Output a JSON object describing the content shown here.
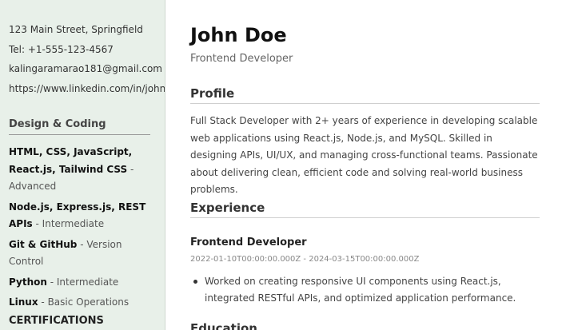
{
  "contact": {
    "address": "123 Main Street, Springfield",
    "phone": "Tel: +1-555-123-4567",
    "email": "kalingaramarao181@gmail.com",
    "linkedin": "https://www.linkedin.com/in/johndoe"
  },
  "skills": {
    "title": "Design & Coding",
    "items": [
      {
        "name": "HTML, CSS, JavaScript, React.js, Tailwind CSS",
        "level": "Advanced"
      },
      {
        "name": "Node.js, Express.js, REST APIs",
        "level": "Intermediate"
      },
      {
        "name": "Git & GitHub",
        "level": "Version Control"
      },
      {
        "name": "Python",
        "level": "Intermediate"
      },
      {
        "name": "Linux",
        "level": "Basic Operations"
      }
    ]
  },
  "certifications": {
    "title": "CERTIFICATIONS"
  },
  "header": {
    "name": "John Doe",
    "role": "Frontend Developer"
  },
  "profile": {
    "title": "Profile",
    "text": "Full Stack Developer with 2+ years of experience in developing scalable web applications using React.js, Node.js, and MySQL. Skilled in designing APIs, UI/UX, and managing cross-functional teams. Passionate about delivering clean, efficient code and solving real-world business problems."
  },
  "experience": {
    "title": "Experience",
    "jobs": [
      {
        "title": "Frontend Developer",
        "dates": "2022-01-10T00:00:00.000Z - 2024-03-15T00:00:00.000Z",
        "bullets": [
          "Worked on creating responsive UI components using React.js, integrated RESTful APIs, and optimized application performance."
        ]
      }
    ]
  },
  "education": {
    "title": "Education"
  }
}
